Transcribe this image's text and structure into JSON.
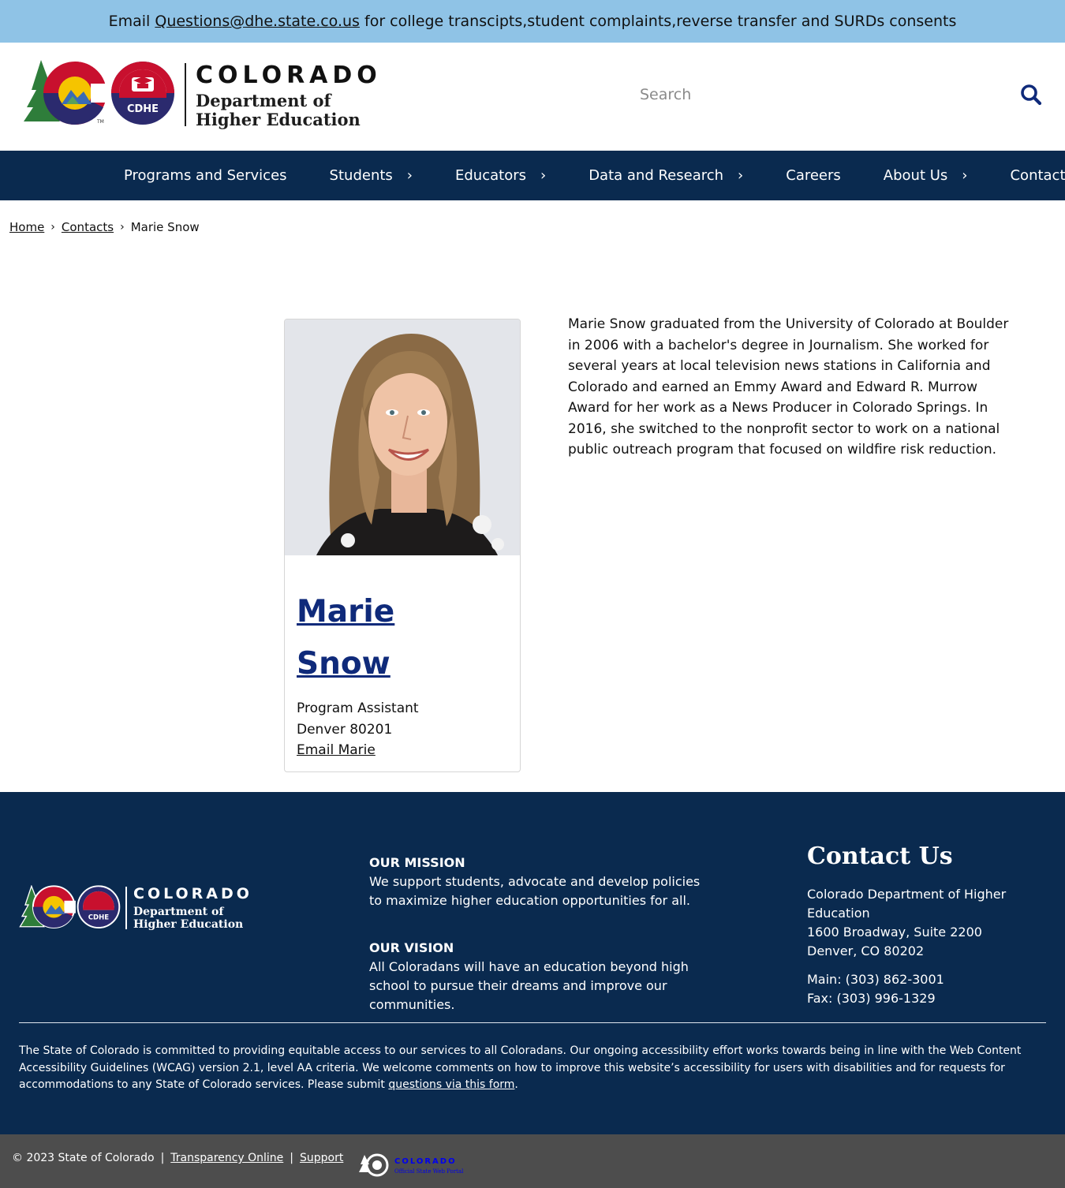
{
  "alert": {
    "prefix": "Email ",
    "email": "Questions@dhe.state.co.us",
    "suffix": " for college transcipts,student complaints,reverse transfer and SURDs consents"
  },
  "header": {
    "logo_colorado": "COLORADO",
    "logo_dept_line1": "Department of",
    "logo_dept_line2": "Higher Education",
    "logo_badge": "CDHE",
    "search_placeholder": "Search"
  },
  "nav": {
    "items": [
      {
        "label": "Programs and Services",
        "has_submenu": false
      },
      {
        "label": "Students",
        "has_submenu": true
      },
      {
        "label": "Educators",
        "has_submenu": true
      },
      {
        "label": "Data and Research",
        "has_submenu": true
      },
      {
        "label": "Careers",
        "has_submenu": false
      },
      {
        "label": "About Us",
        "has_submenu": true
      },
      {
        "label": "Contact Us",
        "has_submenu": false
      }
    ],
    "chevron": "›"
  },
  "breadcrumb": {
    "home": "Home",
    "contacts": "Contacts",
    "current": "Marie Snow",
    "separator": "›"
  },
  "profile": {
    "first_name": "Marie",
    "last_name": "Snow",
    "title": "Program Assistant",
    "location": "Denver 80201",
    "email_link": "Email Marie",
    "bio": "Marie Snow graduated from the University of Colorado at Boulder in 2006 with a bachelor's degree in Journalism. She worked for several years at local television news stations in California and Colorado and earned an Emmy Award and Edward R. Murrow Award for her work as a News Producer in Colorado Springs. In 2016, she switched to the nonprofit sector to work on a national public outreach program that focused on wildfire risk reduction."
  },
  "footer": {
    "mission_heading": "OUR MISSION",
    "mission_text": "We support students, advocate and develop policies to maximize higher education opportunities for all.",
    "vision_heading": "OUR VISION",
    "vision_text": "All Coloradans will have an education beyond high school to pursue their dreams and improve our communities.",
    "contact_heading": "Contact Us",
    "org": "Colorado Department of Higher Education",
    "address1": "1600 Broadway, Suite 2200",
    "address2": "Denver, CO 80202",
    "main": "Main: (303) 862-3001",
    "fax": "Fax: (303) 996-1329",
    "access_text": "The State of Colorado is committed to providing equitable access to our services to all Coloradans. Our ongoing accessibility effort works towards being in line with the Web Content Accessibility Guidelines (WCAG) version 2.1, level AA criteria. We welcome comments on how to improve this website’s accessibility for users with disabilities and for requests for accommodations to any State of Colorado services. Please submit ",
    "access_link": "questions via this form",
    "access_end": "."
  },
  "bottom": {
    "copyright": "© 2023 State of Colorado",
    "sep": "|",
    "transparency": "Transparency Online",
    "support": "Support",
    "portal_colorado": "COLORADO",
    "portal_sub": "Official State Web Portal"
  },
  "colors": {
    "alert_bg": "#8fc3e6",
    "nav_bg": "#0a2a4f",
    "footer_bg": "#0a2a4f",
    "bottom_bg": "#4d4d4d",
    "name_link": "#0f2a7a"
  }
}
